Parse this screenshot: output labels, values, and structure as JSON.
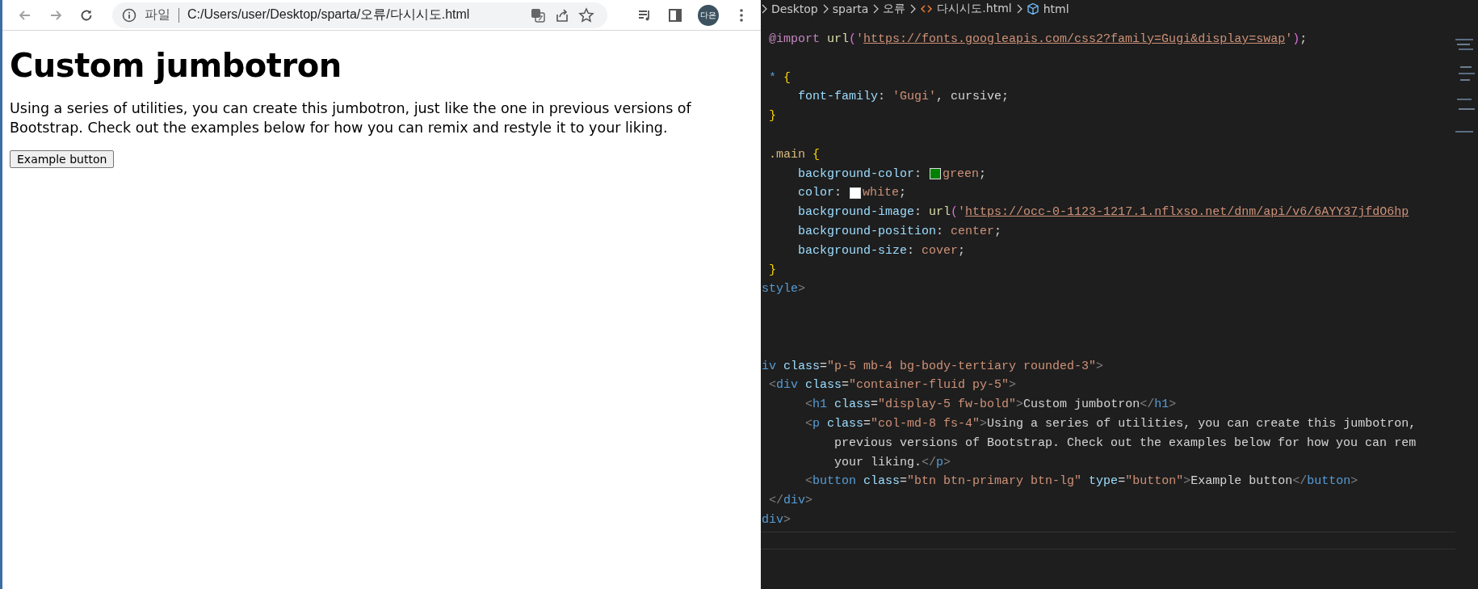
{
  "browser": {
    "page_label": "파일",
    "url": "C:/Users/user/Desktop/sparta/오류/다시시도.html",
    "profile": "다은",
    "page": {
      "heading": "Custom jumbotron",
      "paragraph": "Using a series of utilities, you can create this jumbotron, just like the one in previous versions of Bootstrap. Check out the examples below for how you can remix and restyle it to your liking.",
      "button": "Example button"
    }
  },
  "editor": {
    "breadcrumbs": [
      {
        "text": "Desktop",
        "kind": "folder"
      },
      {
        "text": "sparta",
        "kind": "folder"
      },
      {
        "text": "오류",
        "kind": "folder"
      },
      {
        "text": "다시시도.html",
        "kind": "file"
      },
      {
        "text": "html",
        "kind": "element"
      }
    ],
    "blocks": [
      {
        "kind": "css",
        "lines": [
          [
            {
              "text": " @import",
              "kind": "at"
            },
            {
              "text": " url",
              "kind": "fn"
            },
            {
              "text": "(",
              "kind": "paren"
            },
            {
              "text": "'",
              "kind": "str"
            },
            {
              "text": "https://fonts.googleapis.com/css2?family=Gugi&display=swap",
              "kind": "link"
            },
            {
              "text": "'",
              "kind": "str"
            },
            {
              "text": ")",
              "kind": "paren"
            },
            {
              "text": ";",
              "kind": "plain"
            }
          ]
        ]
      },
      {
        "kind": "css",
        "lines": [
          [
            {
              "text": " *",
              "kind": "op"
            },
            {
              "text": " {",
              "kind": "brace"
            }
          ],
          [
            {
              "text": "     font-family",
              "kind": "prop"
            },
            {
              "text": ": ",
              "kind": "plain"
            },
            {
              "text": "'Gugi'",
              "kind": "str"
            },
            {
              "text": ", cursive;",
              "kind": "plain"
            }
          ],
          [
            {
              "text": " }",
              "kind": "brace"
            }
          ]
        ]
      },
      {
        "kind": "css",
        "lines": [
          [
            {
              "text": " .main",
              "kind": "sel"
            },
            {
              "text": " {",
              "kind": "brace"
            }
          ],
          [
            {
              "text": "     background-color",
              "kind": "prop"
            },
            {
              "text": ": ",
              "kind": "plain"
            },
            {
              "kind": "swatch",
              "color": "#008000"
            },
            {
              "text": "green",
              "kind": "val"
            },
            {
              "text": ";",
              "kind": "plain"
            }
          ],
          [
            {
              "text": "     color",
              "kind": "prop"
            },
            {
              "text": ": ",
              "kind": "plain"
            },
            {
              "kind": "swatch",
              "color": "#ffffff"
            },
            {
              "text": "white",
              "kind": "val"
            },
            {
              "text": ";",
              "kind": "plain"
            }
          ],
          [
            {
              "text": "     background-image",
              "kind": "prop"
            },
            {
              "text": ": ",
              "kind": "plain"
            },
            {
              "text": "url",
              "kind": "fn"
            },
            {
              "text": "(",
              "kind": "paren"
            },
            {
              "text": "'",
              "kind": "str"
            },
            {
              "text": "https://occ-0-1123-1217.1.nflxso.net/dnm/api/v6/6AYY37jfdO6hp",
              "kind": "link"
            }
          ],
          [
            {
              "text": "     background-position",
              "kind": "prop"
            },
            {
              "text": ": ",
              "kind": "plain"
            },
            {
              "text": "center",
              "kind": "val"
            },
            {
              "text": ";",
              "kind": "plain"
            }
          ],
          [
            {
              "text": "     background-size",
              "kind": "prop"
            },
            {
              "text": ": ",
              "kind": "plain"
            },
            {
              "text": "cover",
              "kind": "val"
            },
            {
              "text": ";",
              "kind": "plain"
            }
          ],
          [
            {
              "text": " }",
              "kind": "brace"
            }
          ],
          [
            {
              "text": "style",
              "kind": "tag"
            },
            {
              "text": ">",
              "kind": "bracket"
            }
          ]
        ]
      },
      {
        "kind": "markup",
        "lines": [
          [
            {
              "text": "iv",
              "kind": "tag"
            },
            {
              "text": " class",
              "kind": "attr"
            },
            {
              "text": "=",
              "kind": "plain"
            },
            {
              "text": "\"p-5 mb-4 bg-body-tertiary rounded-3\"",
              "kind": "str"
            },
            {
              "text": ">",
              "kind": "bracket"
            }
          ],
          [
            {
              "text": " <",
              "kind": "bracket"
            },
            {
              "text": "div",
              "kind": "tag"
            },
            {
              "text": " class",
              "kind": "attr"
            },
            {
              "text": "=",
              "kind": "plain"
            },
            {
              "text": "\"container-fluid py-5\"",
              "kind": "str"
            },
            {
              "text": ">",
              "kind": "bracket"
            }
          ],
          [
            {
              "text": "      <",
              "kind": "bracket"
            },
            {
              "text": "h1",
              "kind": "tag"
            },
            {
              "text": " class",
              "kind": "attr"
            },
            {
              "text": "=",
              "kind": "plain"
            },
            {
              "text": "\"display-5 fw-bold\"",
              "kind": "str"
            },
            {
              "text": ">",
              "kind": "bracket"
            },
            {
              "text": "Custom jumbotron",
              "kind": "plain"
            },
            {
              "text": "</",
              "kind": "bracket"
            },
            {
              "text": "h1",
              "kind": "tag"
            },
            {
              "text": ">",
              "kind": "bracket"
            }
          ],
          [
            {
              "text": "      <",
              "kind": "bracket"
            },
            {
              "text": "p",
              "kind": "tag"
            },
            {
              "text": " class",
              "kind": "attr"
            },
            {
              "text": "=",
              "kind": "plain"
            },
            {
              "text": "\"col-md-8 fs-4\"",
              "kind": "str"
            },
            {
              "text": ">",
              "kind": "bracket"
            },
            {
              "text": "Using a series of utilities, you can create this jumbotron,",
              "kind": "plain"
            }
          ],
          [
            {
              "text": "          previous versions of Bootstrap. Check out the examples below for how you can rem",
              "kind": "plain"
            }
          ],
          [
            {
              "text": "          your liking.",
              "kind": "plain"
            },
            {
              "text": "</",
              "kind": "bracket"
            },
            {
              "text": "p",
              "kind": "tag"
            },
            {
              "text": ">",
              "kind": "bracket"
            }
          ],
          [
            {
              "text": "      <",
              "kind": "bracket"
            },
            {
              "text": "button",
              "kind": "tag"
            },
            {
              "text": " class",
              "kind": "attr"
            },
            {
              "text": "=",
              "kind": "plain"
            },
            {
              "text": "\"btn btn-primary btn-lg\"",
              "kind": "str"
            },
            {
              "text": " type",
              "kind": "attr"
            },
            {
              "text": "=",
              "kind": "plain"
            },
            {
              "text": "\"button\"",
              "kind": "str"
            },
            {
              "text": ">",
              "kind": "bracket"
            },
            {
              "text": "Example button",
              "kind": "plain"
            },
            {
              "text": "</",
              "kind": "bracket"
            },
            {
              "text": "button",
              "kind": "tag"
            },
            {
              "text": ">",
              "kind": "bracket"
            }
          ],
          [
            {
              "text": " </",
              "kind": "bracket"
            },
            {
              "text": "div",
              "kind": "tag"
            },
            {
              "text": ">",
              "kind": "bracket"
            }
          ],
          [
            {
              "text": "div",
              "kind": "tag"
            },
            {
              "text": ">",
              "kind": "bracket"
            }
          ]
        ]
      }
    ]
  }
}
